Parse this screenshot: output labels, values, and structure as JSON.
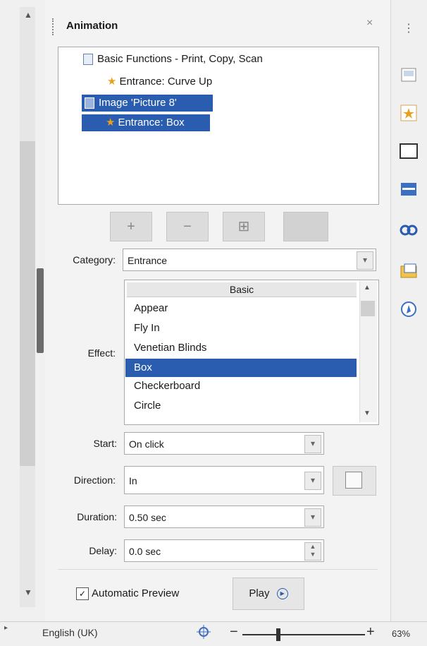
{
  "panel": {
    "title": "Animation",
    "close_label": "×"
  },
  "animation_list": {
    "items": [
      {
        "label": "Basic Functions - Print, Copy, Scan",
        "type": "slide"
      },
      {
        "label": "Entrance: Curve Up",
        "type": "effect"
      },
      {
        "label": "Image 'Picture 8'",
        "type": "image",
        "selected": true
      },
      {
        "label": "Entrance: Box",
        "type": "effect",
        "selected": true
      }
    ]
  },
  "buttons": {
    "add": "+",
    "remove": "−",
    "modify": "⊞",
    "empty": ""
  },
  "category": {
    "label": "Category:",
    "value": "Entrance"
  },
  "effect": {
    "label": "Effect:",
    "group_header": "Basic",
    "items": [
      "Appear",
      "Fly In",
      "Venetian Blinds",
      "Box",
      "Checkerboard",
      "Circle"
    ],
    "selected": "Box"
  },
  "start": {
    "label": "Start:",
    "value": "On click"
  },
  "direction": {
    "label": "Direction:",
    "value": "In"
  },
  "duration": {
    "label": "Duration:",
    "value": "0.50 sec"
  },
  "delay": {
    "label": "Delay:",
    "value": "0.0 sec"
  },
  "bottom": {
    "auto_preview_label": "Automatic Preview",
    "auto_preview_checked": true,
    "play_label": "Play"
  },
  "status": {
    "language": "English (UK)",
    "zoom_percent": "63%",
    "zoom_minus": "−",
    "zoom_plus": "+"
  },
  "colors": {
    "selection": "#2a5db0",
    "star": "#e8a11a"
  }
}
